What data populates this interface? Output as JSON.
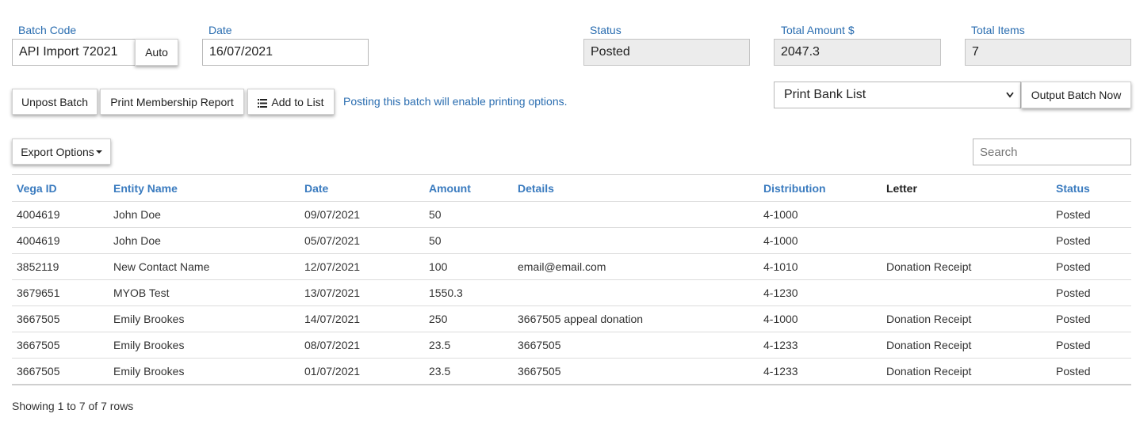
{
  "header": {
    "batch_code": {
      "label": "Batch Code",
      "value": "API Import 72021",
      "auto_label": "Auto"
    },
    "date": {
      "label": "Date",
      "value": "16/07/2021"
    },
    "status": {
      "label": "Status",
      "value": "Posted"
    },
    "total_amount": {
      "label": "Total Amount $",
      "value": "2047.3"
    },
    "total_items": {
      "label": "Total Items",
      "value": "7"
    }
  },
  "actions": {
    "unpost_label": "Unpost Batch",
    "print_membership_label": "Print Membership Report",
    "add_to_list_label": "Add to List",
    "info_text": "Posting this batch will enable printing options.",
    "print_select_value": "Print Bank List",
    "output_label": "Output Batch Now",
    "export_label": "Export Options",
    "search_placeholder": "Search"
  },
  "table": {
    "columns": [
      "Vega ID",
      "Entity Name",
      "Date",
      "Amount",
      "Details",
      "Distribution",
      "Letter",
      "Status"
    ],
    "rows": [
      [
        "4004619",
        "John Doe",
        "09/07/2021",
        "50",
        "",
        "4-1000",
        "",
        "Posted"
      ],
      [
        "4004619",
        "John Doe",
        "05/07/2021",
        "50",
        "",
        "4-1000",
        "",
        "Posted"
      ],
      [
        "3852119",
        "New Contact Name",
        "12/07/2021",
        "100",
        "email@email.com",
        "4-1010",
        "Donation Receipt",
        "Posted"
      ],
      [
        "3679651",
        "MYOB Test",
        "13/07/2021",
        "1550.3",
        "",
        "4-1230",
        "",
        "Posted"
      ],
      [
        "3667505",
        "Emily Brookes",
        "14/07/2021",
        "250",
        "3667505 appeal donation",
        "4-1000",
        "Donation Receipt",
        "Posted"
      ],
      [
        "3667505",
        "Emily Brookes",
        "08/07/2021",
        "23.5",
        "3667505",
        "4-1233",
        "Donation Receipt",
        "Posted"
      ],
      [
        "3667505",
        "Emily Brookes",
        "01/07/2021",
        "23.5",
        "3667505",
        "4-1233",
        "Donation Receipt",
        "Posted"
      ]
    ]
  },
  "footer": {
    "pagination_text": "Showing 1 to 7 of 7 rows"
  },
  "icons": {
    "add_to_list": "list-icon",
    "select_chevron": "chevron-down-icon",
    "export_caret": "caret-down-icon"
  },
  "colors": {
    "label_blue": "#2a6db0",
    "header_blue": "#3a7bbf",
    "readonly_bg": "#ececec"
  }
}
